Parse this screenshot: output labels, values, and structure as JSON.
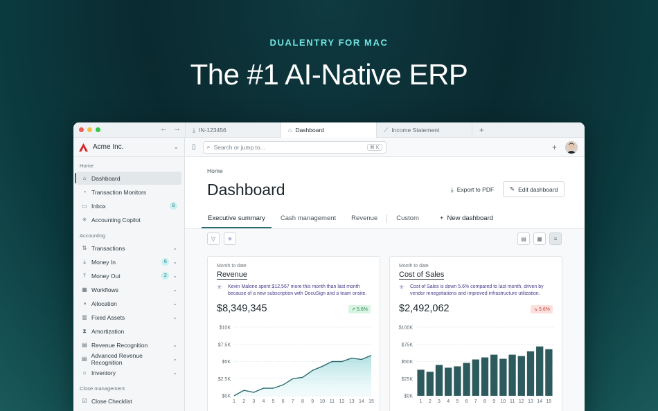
{
  "hero": {
    "eyebrow": "DUALENTRY FOR MAC",
    "title": "The #1 AI-Native ERP"
  },
  "titlebar": {
    "tabs": [
      {
        "label": "IN-123456",
        "icon": "download-icon"
      },
      {
        "label": "Dashboard",
        "icon": "home-icon",
        "active": true
      },
      {
        "label": "Income Statement",
        "icon": "chart-icon"
      }
    ]
  },
  "sidebar": {
    "org_name": "Acme Inc.",
    "sections": [
      {
        "title": "Home",
        "items": [
          {
            "label": "Dashboard",
            "icon": "home-icon",
            "active": true
          },
          {
            "label": "Transaction Monitors",
            "icon": "monitor-icon"
          },
          {
            "label": "Inbox",
            "icon": "inbox-icon",
            "badge": "8"
          },
          {
            "label": "Accounting Copilot",
            "icon": "sparkle-icon"
          }
        ]
      },
      {
        "title": "Accounting",
        "items": [
          {
            "label": "Transactions",
            "icon": "transfer-icon",
            "chevron": true
          },
          {
            "label": "Money In",
            "icon": "money-in-icon",
            "badge": "6",
            "chevron": true
          },
          {
            "label": "Money Out",
            "icon": "money-out-icon",
            "badge": "2",
            "chevron": true
          },
          {
            "label": "Workflows",
            "icon": "workflow-icon",
            "chevron": true
          },
          {
            "label": "Allocation",
            "icon": "pie-icon",
            "chevron": true
          },
          {
            "label": "Fixed Assets",
            "icon": "building-icon",
            "chevron": true
          },
          {
            "label": "Amortization",
            "icon": "hourglass-icon"
          },
          {
            "label": "Revenue Recognition",
            "icon": "ledger-icon",
            "chevron": true
          },
          {
            "label": "Advanced Revenue Recognition",
            "icon": "ledger-icon",
            "chevron": true
          },
          {
            "label": "Inventory",
            "icon": "warehouse-icon",
            "chevron": true
          }
        ]
      },
      {
        "title": "Close management",
        "items": [
          {
            "label": "Close Checklist",
            "icon": "checkbox-icon"
          }
        ]
      }
    ]
  },
  "topbar": {
    "search_placeholder": "Search or jump to...",
    "shortcut": "⌘ K"
  },
  "page": {
    "breadcrumb": "Home",
    "title": "Dashboard",
    "export_label": "Export to PDF",
    "edit_label": "Edit dashboard",
    "tabs": [
      "Executive summary",
      "Cash management",
      "Revenue",
      "Custom"
    ],
    "new_dashboard_label": "New dashboard"
  },
  "cards": [
    {
      "period": "Month to date",
      "title": "Revenue",
      "insight": "Kevin Malone spent $12,567 more this month than last month because of a new subscription with DocuSign and a team onsite.",
      "amount": "$8,349,345",
      "delta": "5.6%",
      "delta_dir": "up"
    },
    {
      "period": "Month to date",
      "title": "Cost of Sales",
      "insight": "Cost of Sales is down 5.6% compared to last month, driven by vendor renegotiations and improved infrastructure utilization.",
      "amount": "$2,492,062",
      "delta": "5.6%",
      "delta_dir": "down"
    }
  ],
  "chart_data": [
    {
      "type": "area",
      "title": "Revenue",
      "x": [
        1,
        2,
        3,
        4,
        5,
        6,
        7,
        8,
        9,
        10,
        11,
        12,
        13,
        14,
        15
      ],
      "values": [
        0,
        0.8,
        0.5,
        1.1,
        1.1,
        1.6,
        2.5,
        2.7,
        3.7,
        4.3,
        5.0,
        5.0,
        5.5,
        5.3,
        5.9
      ],
      "y_ticks": [
        "$0K",
        "$2.5K",
        "$5K",
        "$7.5K",
        "$10K"
      ],
      "ylim": [
        0,
        10
      ],
      "color": "#2c6a70",
      "grid": true
    },
    {
      "type": "bar",
      "title": "Cost of Sales",
      "x": [
        1,
        2,
        3,
        4,
        5,
        6,
        7,
        8,
        9,
        10,
        11,
        12,
        13,
        14,
        15
      ],
      "values": [
        38,
        35,
        45,
        41,
        43,
        48,
        53,
        56,
        60,
        54,
        60,
        58,
        65,
        72,
        68
      ],
      "y_ticks": [
        "$0K",
        "$25K",
        "$50K",
        "$75K",
        "$100K"
      ],
      "ylim": [
        0,
        100
      ],
      "color": "#2d5a5c",
      "grid": true
    }
  ]
}
